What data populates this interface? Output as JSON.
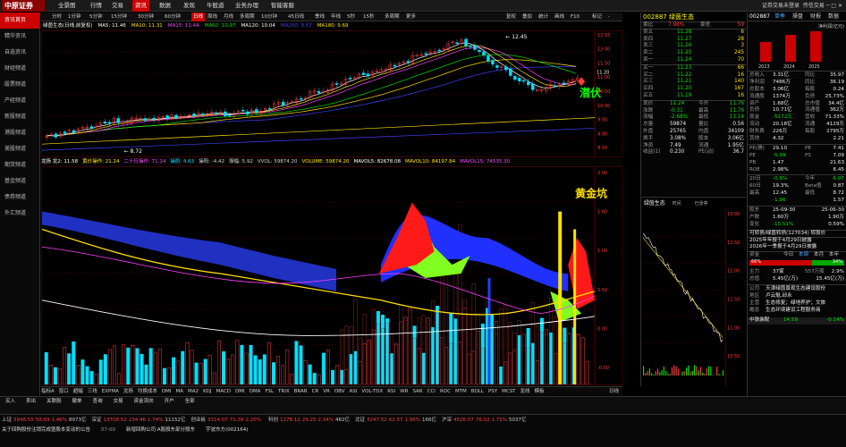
{
  "topbar": {
    "logo": "中原证券",
    "menu": [
      "全景图",
      "行情",
      "交易",
      "资讯",
      "数据",
      "发现",
      "牛股道",
      "业务办理",
      "智能客服"
    ],
    "active_menu": "资讯",
    "right_text": "证券交易未登录",
    "right_text2": "传信交易"
  },
  "sidebar": {
    "items": [
      "资讯首页",
      "精华资讯",
      "自选资讯",
      "财经频道",
      "股票频道",
      "产经频道",
      "新股频道",
      "港股频道",
      "美股频道",
      "期货频道",
      "基金频道",
      "债券频道",
      "外汇频道"
    ],
    "active": "资讯首页"
  },
  "period_bar": {
    "items": [
      "分时",
      "1分钟",
      "5分钟",
      "15分钟",
      "30分钟",
      "60分钟",
      "日线",
      "周线",
      "月线",
      "多周期",
      "10分钟",
      "45日线",
      "季线",
      "年线",
      "5秒",
      "15秒",
      "多周期",
      "更多"
    ],
    "active": "日线",
    "right_items": [
      "复权",
      "叠加",
      "统计",
      "画线",
      "F10",
      "标记",
      "-"
    ]
  },
  "ma_legend": {
    "title": "绿茵生态(日线,前复权)",
    "items": [
      {
        "label": "MA5: 11.46",
        "color": "#ffffff"
      },
      {
        "label": "MA10: 11.31",
        "color": "#ffe000"
      },
      {
        "label": "MA15: 11.44",
        "color": "#ff40ff"
      },
      {
        "label": "MA60: 10.97",
        "color": "#00e000"
      },
      {
        "label": "MA120: 10.04",
        "color": "#ffffff"
      },
      {
        "label": "MA250: 9.57",
        "color": "#4040ff"
      },
      {
        "label": "MA180: 9.69",
        "color": "#ffe000"
      }
    ]
  },
  "main_chart": {
    "high_label": "12.45",
    "low_label": "8.72",
    "price_label": "11.20",
    "annotation": "潜伏",
    "axis": [
      "12.55",
      "12.00",
      "11.50",
      "11.00",
      "10.50",
      "10.00",
      "9.50",
      "9.00",
      "8.50"
    ]
  },
  "indicator_bar": {
    "items": [
      {
        "label": "龙扬 龙2: 11.58",
        "color": "#ffffff"
      },
      {
        "label": "黄价操作: 21.24",
        "color": "#ffe000"
      },
      {
        "label": "二十日操作: 71.14",
        "color": "#ff40ff"
      },
      {
        "label": "操防: 4.63",
        "color": "#00e0ff"
      },
      {
        "label": "操阳: -4.42",
        "color": "#cccccc"
      },
      {
        "label": "振幅: 5.92",
        "color": "#cccccc"
      },
      {
        "label": "VVOL: 59874.20",
        "color": "#cccccc"
      },
      {
        "label": "VOLUME: 59874.20",
        "color": "#ffe000"
      },
      {
        "label": "MAVOL5: 82678.08",
        "color": "#ffffff"
      },
      {
        "label": "MAVOL10: 84197.84",
        "color": "#ffe000"
      },
      {
        "label": "MAVOL15: 74535.30",
        "color": "#ff40ff"
      }
    ]
  },
  "lower_chart": {
    "annotation": "黄金坑",
    "axis": [
      "2.00",
      "1.60",
      "1.00",
      "0.50",
      "0.00",
      "-0.50"
    ]
  },
  "bottom_tabs": {
    "items": [
      "指标A",
      "窗口",
      "超幅",
      "三线",
      "EXPMA",
      "龙扬",
      "均换成本",
      "DMI",
      "MA",
      "MA2",
      "KDJ",
      "MACD",
      "DMI",
      "DMA",
      "FSL",
      "TRIX",
      "BRAR",
      "CR",
      "VR",
      "OBV",
      "ASI",
      "VOL-TDX",
      "RSI",
      "WR",
      "SAR",
      "CCI",
      "ROC",
      "MTM",
      "BOLL",
      "PSY",
      "MCST",
      "龙线",
      "模板"
    ],
    "right": "日线"
  },
  "quote_panel": {
    "code": "002887",
    "name": "绿茵生态",
    "weibi_label": "委比",
    "weibi": "7.98%",
    "weicha_label": "委差",
    "weicha": "59",
    "asks": [
      {
        "label": "卖五",
        "price": "11.28",
        "vol": "6"
      },
      {
        "label": "卖四",
        "price": "11.27",
        "vol": "28"
      },
      {
        "label": "卖三",
        "price": "11.26",
        "vol": "3"
      },
      {
        "label": "卖二",
        "price": "11.25",
        "vol": "245"
      },
      {
        "label": "卖一",
        "price": "11.24",
        "vol": "70"
      }
    ],
    "bids": [
      {
        "label": "买一",
        "price": "11.23",
        "vol": "66"
      },
      {
        "label": "买二",
        "price": "11.22",
        "vol": "16"
      },
      {
        "label": "买三",
        "price": "11.21",
        "vol": "140"
      },
      {
        "label": "买四",
        "price": "11.20",
        "vol": "167"
      },
      {
        "label": "买五",
        "price": "11.19",
        "vol": "16"
      }
    ],
    "stats": [
      {
        "l1": "现价",
        "v1": "11.24",
        "l2": "今开",
        "v2": "11.76"
      },
      {
        "l1": "涨跌",
        "v1": "-0.31",
        "l2": "最高",
        "v2": "11.76"
      },
      {
        "l1": "涨幅",
        "v1": "-2.68%",
        "l2": "最低",
        "v2": "11.14"
      },
      {
        "l1": "总量",
        "v1": "59874",
        "l2": "量比",
        "v2": "0.56"
      },
      {
        "l1": "外盘",
        "v1": "25765",
        "l2": "内盘",
        "v2": "34109"
      },
      {
        "l1": "换手",
        "v1": "3.08%",
        "l2": "股本",
        "v2": "3.06亿"
      },
      {
        "l1": "净资",
        "v1": "7.49",
        "l2": "流通",
        "v2": "1.95亿"
      },
      {
        "l1": "收益(1)",
        "v1": "0.230",
        "l2": "PE(动)",
        "v2": "36.7"
      }
    ]
  },
  "mini_chart": {
    "title": "绿茵生态",
    "axis": [
      "13.00",
      "12.50",
      "12.00",
      "11.50",
      "11.00",
      "10.50"
    ],
    "labels": [
      "时间",
      "已涨停"
    ]
  },
  "fin_panel": {
    "code": "002887",
    "tabs": [
      "单季",
      "操盘",
      "财报",
      "数据"
    ],
    "years": [
      "2023",
      "2024",
      "2025"
    ],
    "chart_label": "净利润(亿元)",
    "rows": [
      {
        "l1": "总收入",
        "v1": "3.31亿",
        "l2": "同比",
        "v2": "35.97"
      },
      {
        "l1": "净利润",
        "v1": "7486万",
        "l2": "同比",
        "v2": "36.19"
      },
      {
        "l1": "总股本",
        "v1": "3.06亿",
        "l2": "每股",
        "v2": "0.24"
      },
      {
        "l1": "流通股",
        "v1": "1374万",
        "l2": "负债",
        "v2": "25.73%"
      },
      {
        "l1": "资产",
        "v1": "1.68亿",
        "l2": "总市值",
        "v2": "34.4亿"
      },
      {
        "l1": "负债",
        "v1": "10.71亿",
        "l2": "流通值",
        "v2": "362万"
      },
      {
        "l1": "现金",
        "v1": "-5172万",
        "l2": "营收",
        "v2": "71.33%"
      },
      {
        "l1": "流动",
        "v1": "20.18亿",
        "l2": "流通",
        "v2": "4129万"
      },
      {
        "l1": "财务费",
        "v1": "226万",
        "l2": "每股",
        "v2": "2795万"
      },
      {
        "l1": "其他",
        "v1": "4.32",
        "l2": "",
        "v2": "2.21"
      }
    ],
    "val_rows": [
      {
        "l1": "PE(静)",
        "v1": "29.10",
        "l2": "PE",
        "v2": "7.41"
      },
      {
        "l1": "PE",
        "v1": "-5.99",
        "l2": "PS",
        "v2": "7.09"
      },
      {
        "l1": "PB",
        "v1": "1.47",
        "l2": "",
        "v2": "21.63"
      },
      {
        "l1": "ROE",
        "v1": "2.98%",
        "l2": "",
        "v2": "6.45"
      }
    ],
    "perf_rows": [
      {
        "l1": "20日",
        "v1": "-0.8%",
        "l2": "今年",
        "v2": "-6.07"
      },
      {
        "l1": "60日",
        "v1": "19.3%",
        "l2": "Beta值",
        "v2": "0.87"
      },
      {
        "l1": "最高",
        "v1": "12.45",
        "l2": "最低",
        "v2": "8.72"
      },
      {
        "l1": "",
        "v1": "-1.96",
        "l2": "",
        "v2": "1.57"
      }
    ],
    "dividend_rows": [
      {
        "l1": "股东",
        "v1": "25-09-30",
        "l2": "",
        "v2": "25-06-30"
      },
      {
        "l1": "户数",
        "v1": "1.60万",
        "l2": "",
        "v2": "1.90万"
      },
      {
        "l1": "变化",
        "v1": "-15.51%",
        "l2": "",
        "v2": "0.59%"
      }
    ],
    "notice": "可转债/绿茵转债(127034) 转股价",
    "reports": [
      "2025年年报于4月29日披露",
      "2026年一季报于4月29日披露"
    ],
    "flow_tabs": [
      "今日",
      "本周",
      "本月",
      "本年"
    ],
    "flow_label": "资金",
    "flow_pct_in": "66%",
    "flow_pct_out": "34%",
    "flow_rows": [
      {
        "l1": "主力",
        "v1": "37家",
        "l2": "557万股",
        "v2": "2.9%"
      },
      {
        "l1": "总值",
        "v1": "5.45亿(万)",
        "l2": "",
        "v2": "15.45亿(万)"
      }
    ],
    "company_rows": [
      {
        "l1": "公司",
        "v1": "天津绿茵景观生态建设股份"
      },
      {
        "l1": "地区",
        "v1": "卢云魁,邱永"
      },
      {
        "l1": "主营",
        "v1": "生态修复；绿地养护；文旅"
      },
      {
        "l1": "概念",
        "v1": "生态环境建设工程服务商"
      }
    ],
    "news_title": "中铁装配",
    "news_value": "14.59",
    "news_change": "-0.14%"
  },
  "trade_bar": {
    "items": [
      "买入",
      "卖出",
      "关联股",
      "撤单",
      "查询",
      "交易",
      "资金流向",
      "开户",
      "全部"
    ],
    "right": "关联股"
  },
  "status_bar": {
    "indices": [
      {
        "name": "上证",
        "value": "3948.55",
        "change": "58.69",
        "pct": "1.46%",
        "amount": "8973亿"
      },
      {
        "name": "深证",
        "value": "13708.52",
        "change": "234.46",
        "pct": "1.74%",
        "amount": "11152亿"
      },
      {
        "name": "创业板",
        "value": "3314.07",
        "change": "71.39",
        "pct": "2.20%",
        "amount": ""
      },
      {
        "name": "科创",
        "value": "1278.12",
        "change": "29.25",
        "pct": "2.34%",
        "amount": "482亿"
      },
      {
        "name": "北证",
        "value": "3247.52",
        "change": "62.57",
        "pct": "1.96%",
        "amount": "166亿"
      },
      {
        "name": "沪深",
        "value": "4526.07",
        "change": "76.02",
        "pct": "1.71%",
        "amount": "5037亿"
      }
    ],
    "news": "关于回购股份注销完成暨股本变动的公告",
    "time": "07-00",
    "right_news": "新增回购公司:A股股东部分股东",
    "right_news2": "宇波东方(002164)"
  }
}
